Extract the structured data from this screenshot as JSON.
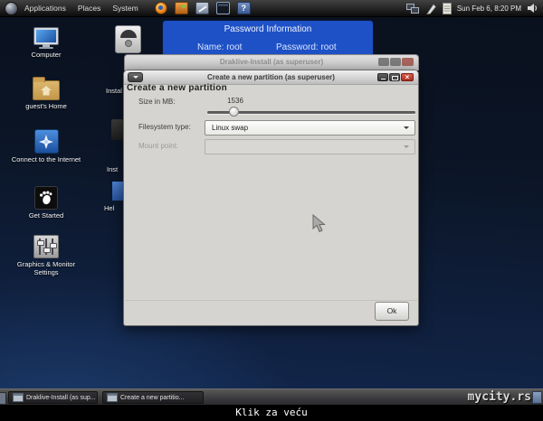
{
  "panel": {
    "menus": [
      {
        "label": "Applications"
      },
      {
        "label": "Places"
      },
      {
        "label": "System"
      }
    ],
    "clock": "Sun Feb 6, 8:20 PM"
  },
  "glyphs": {
    "close": "×",
    "question": "?"
  },
  "desktop": {
    "icons": [
      {
        "label": "Computer"
      },
      {
        "label": "guest's Home"
      },
      {
        "label": "Connect to the Internet"
      },
      {
        "label": "Get Started"
      },
      {
        "label": "Graphics & Monitor",
        "label2": "Settings"
      }
    ],
    "fragments": [
      {
        "label": "Instal"
      },
      {
        "label": "Inst"
      },
      {
        "label": "Hel"
      }
    ]
  },
  "password_window": {
    "title": "Password Information",
    "name": "Name: root",
    "password": "Password: root"
  },
  "back_window": {
    "title": "Draklive-Install (as superuser)"
  },
  "dialog": {
    "title": "Create a new partition (as superuser)",
    "header": "Create a new partition",
    "size_label": "Size in MB:",
    "size_value": "1536",
    "filesystem_label": "Filesystem type:",
    "filesystem_value": "Linux swap",
    "mount_label": "Mount point:",
    "ok_label": "Ok"
  },
  "taskbar": {
    "tasks": [
      {
        "label": "Draklive-Install (as sup..."
      },
      {
        "label": "Create a new partitio..."
      }
    ],
    "watermark": "mycity.rs"
  },
  "caption": "Klik za veću",
  "colors": {
    "accent_blue": "#1e51c6",
    "close_red": "#c2392c",
    "desktop_navy": "#102141"
  }
}
